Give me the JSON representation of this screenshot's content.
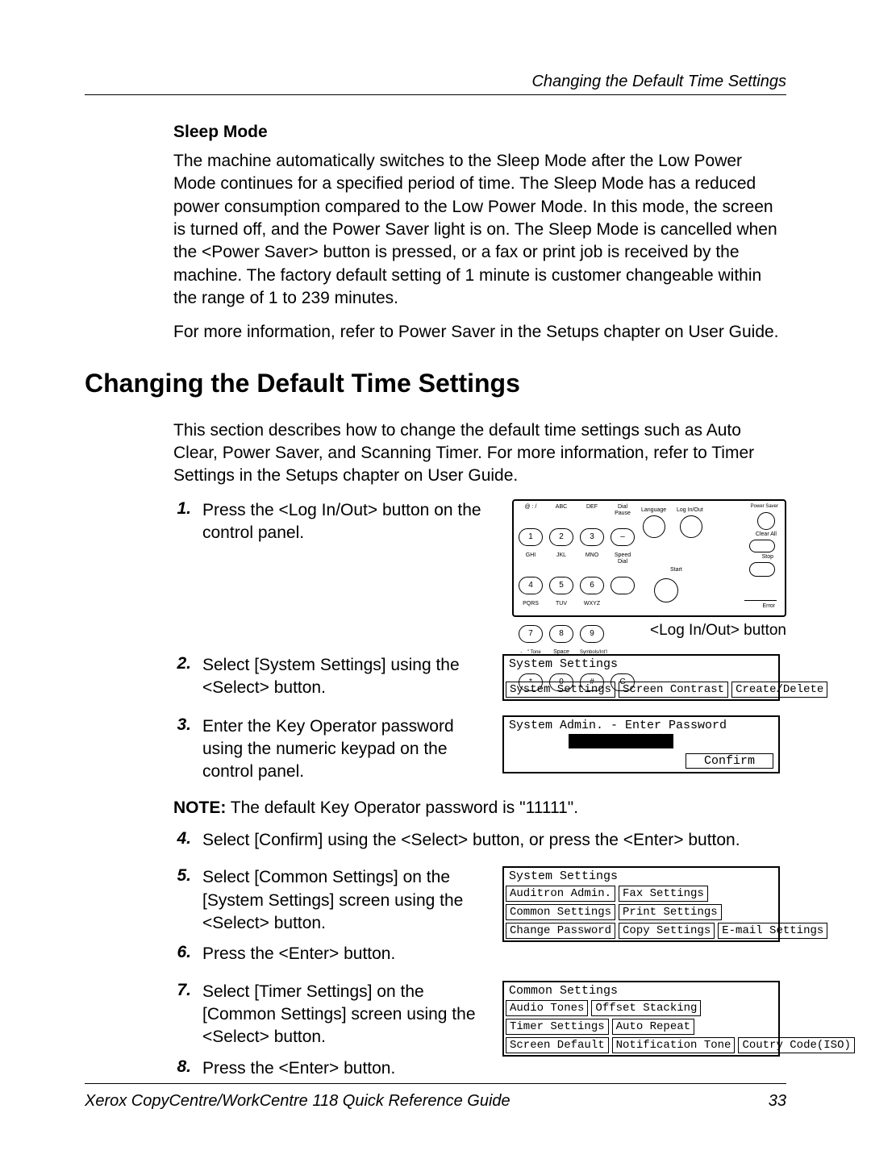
{
  "header": {
    "right": "Changing the Default Time Settings"
  },
  "sleep": {
    "heading": "Sleep Mode",
    "para": "The machine automatically switches to the Sleep Mode after the Low Power Mode continues for a specified period of time. The Sleep Mode has a reduced power consumption compared to the Low Power Mode. In this mode, the screen is turned off, and the Power Saver light is on. The Sleep Mode is cancelled when the <Power Saver> button is pressed, or a fax or print job is received by the machine. The factory default setting of 1 minute is customer changeable within the range of 1 to 239 minutes.",
    "more": "For more information, refer to Power Saver in the Setups chapter on User Guide."
  },
  "section_title": "Changing the Default Time Settings",
  "intro": "This section describes how to change the default time settings such as Auto Clear, Power Saver, and Scanning Timer. For more information, refer to Timer Settings in the Setups chapter on User Guide.",
  "steps": {
    "s1": {
      "num": "1.",
      "text": "Press the <Log In/Out> button on the control panel."
    },
    "s2": {
      "num": "2.",
      "text": "Select [System Settings] using the <Select> button."
    },
    "s3": {
      "num": "3.",
      "text": "Enter the Key Operator password using the numeric keypad on the control panel."
    },
    "s4": {
      "num": "4.",
      "text": "Select [Confirm] using the <Select> button, or press the <Enter> button."
    },
    "s5": {
      "num": "5.",
      "text": "Select [Common Settings] on the [System Settings] screen using the <Select> button."
    },
    "s6": {
      "num": "6.",
      "text": "Press the <Enter> button."
    },
    "s7": {
      "num": "7.",
      "text": "Select [Timer Settings] on the [Common Settings] screen using the <Select> button."
    },
    "s8": {
      "num": "8.",
      "text": "Press the <Enter> button."
    }
  },
  "note": {
    "label": "NOTE:",
    "text": " The default Key Operator password is \"11111\"."
  },
  "panel": {
    "row1_labels": [
      "@ : /",
      "ABC",
      "DEF",
      "Dial Pause"
    ],
    "row1_keys": [
      "1",
      "2",
      "3",
      "–"
    ],
    "row2_labels": [
      "GHI",
      "JKL",
      "MNO",
      "Speed Dial"
    ],
    "row2_keys": [
      "4",
      "5",
      "6",
      ""
    ],
    "row3_labels": [
      "PQRS",
      "TUV",
      "WXYZ",
      ""
    ],
    "row3_keys": [
      "7",
      "8",
      "9",
      ""
    ],
    "row4_labels": [
      "- _ \" Tone",
      "Space",
      "Symbols/Int'l",
      ""
    ],
    "row4_keys": [
      "*",
      "0",
      "#",
      "C"
    ],
    "lang": "Language",
    "loginout": "Log In/Out",
    "powersaver": "Power Saver",
    "clearall": "Clear All",
    "stop": "Stop",
    "start": "Start",
    "error": "Error",
    "caption": "<Log In/Out> button"
  },
  "lcd": {
    "screen1": {
      "title": "System Settings",
      "cells": [
        "System Settings",
        "Screen Contrast",
        "Create/Delete"
      ]
    },
    "screen2": {
      "title": "System Admin. - Enter Password",
      "confirm": "Confirm"
    },
    "screen3": {
      "title": "System Settings",
      "rows": [
        [
          "Auditron Admin.",
          "Fax Settings",
          ""
        ],
        [
          "Common Settings",
          "Print Settings",
          ""
        ],
        [
          "Change Password",
          "Copy Settings",
          "E-mail Settings"
        ]
      ]
    },
    "screen4": {
      "title": "Common Settings",
      "rows": [
        [
          "Audio Tones",
          "Offset Stacking",
          ""
        ],
        [
          "Timer Settings",
          "Auto Repeat",
          ""
        ],
        [
          "Screen Default",
          "Notification Tone",
          "Coutry Code(ISO)"
        ]
      ]
    }
  },
  "footer": {
    "left": "Xerox CopyCentre/WorkCentre 118 Quick Reference Guide",
    "right": "33"
  }
}
